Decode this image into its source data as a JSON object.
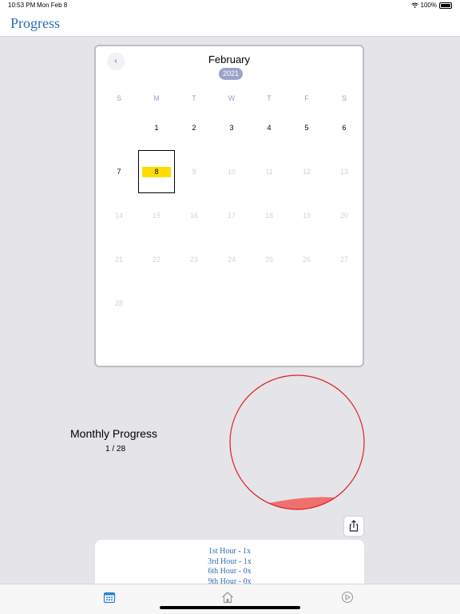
{
  "status": {
    "time": "10:53 PM",
    "date": "Mon Feb 8",
    "battery": "100%"
  },
  "nav": {
    "title": "Progress"
  },
  "calendar": {
    "back": "‹",
    "month": "February",
    "year": "2021",
    "weekdays": [
      "S",
      "M",
      "T",
      "W",
      "T",
      "F",
      "S"
    ],
    "days": [
      {
        "label": "1",
        "state": "active"
      },
      {
        "label": "2",
        "state": "active"
      },
      {
        "label": "3",
        "state": "active"
      },
      {
        "label": "4",
        "state": "active"
      },
      {
        "label": "5",
        "state": "active"
      },
      {
        "label": "6",
        "state": "active"
      },
      {
        "label": "7",
        "state": "active"
      },
      {
        "label": "8",
        "state": "today"
      },
      {
        "label": "9",
        "state": "inactive"
      },
      {
        "label": "10",
        "state": "inactive"
      },
      {
        "label": "11",
        "state": "inactive"
      },
      {
        "label": "12",
        "state": "inactive"
      },
      {
        "label": "13",
        "state": "inactive"
      },
      {
        "label": "14",
        "state": "inactive"
      },
      {
        "label": "15",
        "state": "inactive"
      },
      {
        "label": "16",
        "state": "inactive"
      },
      {
        "label": "17",
        "state": "inactive"
      },
      {
        "label": "18",
        "state": "inactive"
      },
      {
        "label": "19",
        "state": "inactive"
      },
      {
        "label": "20",
        "state": "inactive"
      },
      {
        "label": "21",
        "state": "inactive"
      },
      {
        "label": "22",
        "state": "inactive"
      },
      {
        "label": "23",
        "state": "inactive"
      },
      {
        "label": "24",
        "state": "inactive"
      },
      {
        "label": "25",
        "state": "inactive"
      },
      {
        "label": "26",
        "state": "inactive"
      },
      {
        "label": "27",
        "state": "inactive"
      },
      {
        "label": "28",
        "state": "inactive"
      }
    ],
    "first_weekday": 1
  },
  "progress": {
    "title": "Monthly Progress",
    "count": "1 / 28",
    "fraction": 0.0357
  },
  "colors": {
    "accent": "#2f6db5",
    "today_highlight": "#ffdd00",
    "circle_stroke": "#e02020",
    "circle_fill": "#f07070"
  },
  "hours": [
    "1st Hour - 1x",
    "3rd Hour - 1x",
    "6th Hour - 0x",
    "9th Hour - 0x"
  ],
  "tabs": [
    {
      "icon": "calendar-icon",
      "active": true
    },
    {
      "icon": "home-icon",
      "active": false
    },
    {
      "icon": "compass-icon",
      "active": false
    }
  ]
}
